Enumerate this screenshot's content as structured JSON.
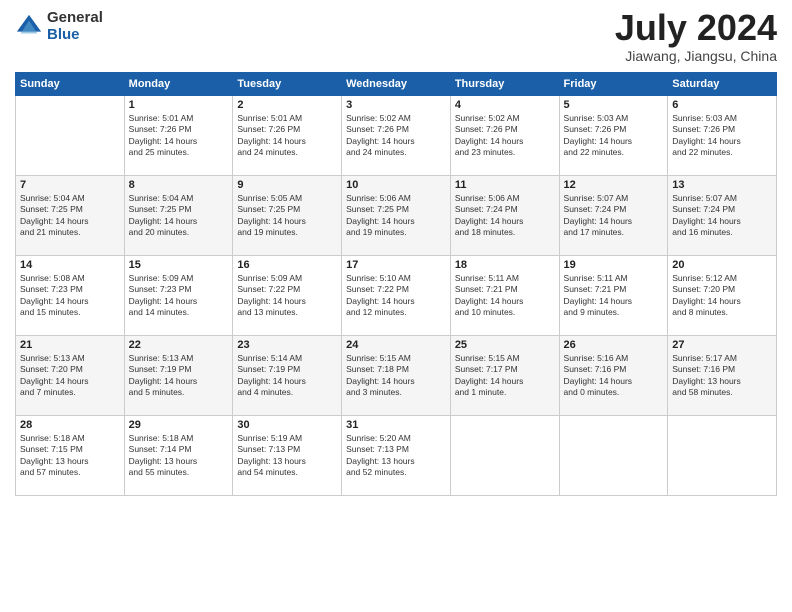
{
  "logo": {
    "general": "General",
    "blue": "Blue"
  },
  "title": "July 2024",
  "location": "Jiawang, Jiangsu, China",
  "days_of_week": [
    "Sunday",
    "Monday",
    "Tuesday",
    "Wednesday",
    "Thursday",
    "Friday",
    "Saturday"
  ],
  "weeks": [
    [
      {
        "day": "",
        "info": ""
      },
      {
        "day": "1",
        "info": "Sunrise: 5:01 AM\nSunset: 7:26 PM\nDaylight: 14 hours\nand 25 minutes."
      },
      {
        "day": "2",
        "info": "Sunrise: 5:01 AM\nSunset: 7:26 PM\nDaylight: 14 hours\nand 24 minutes."
      },
      {
        "day": "3",
        "info": "Sunrise: 5:02 AM\nSunset: 7:26 PM\nDaylight: 14 hours\nand 24 minutes."
      },
      {
        "day": "4",
        "info": "Sunrise: 5:02 AM\nSunset: 7:26 PM\nDaylight: 14 hours\nand 23 minutes."
      },
      {
        "day": "5",
        "info": "Sunrise: 5:03 AM\nSunset: 7:26 PM\nDaylight: 14 hours\nand 22 minutes."
      },
      {
        "day": "6",
        "info": "Sunrise: 5:03 AM\nSunset: 7:26 PM\nDaylight: 14 hours\nand 22 minutes."
      }
    ],
    [
      {
        "day": "7",
        "info": "Sunrise: 5:04 AM\nSunset: 7:25 PM\nDaylight: 14 hours\nand 21 minutes."
      },
      {
        "day": "8",
        "info": "Sunrise: 5:04 AM\nSunset: 7:25 PM\nDaylight: 14 hours\nand 20 minutes."
      },
      {
        "day": "9",
        "info": "Sunrise: 5:05 AM\nSunset: 7:25 PM\nDaylight: 14 hours\nand 19 minutes."
      },
      {
        "day": "10",
        "info": "Sunrise: 5:06 AM\nSunset: 7:25 PM\nDaylight: 14 hours\nand 19 minutes."
      },
      {
        "day": "11",
        "info": "Sunrise: 5:06 AM\nSunset: 7:24 PM\nDaylight: 14 hours\nand 18 minutes."
      },
      {
        "day": "12",
        "info": "Sunrise: 5:07 AM\nSunset: 7:24 PM\nDaylight: 14 hours\nand 17 minutes."
      },
      {
        "day": "13",
        "info": "Sunrise: 5:07 AM\nSunset: 7:24 PM\nDaylight: 14 hours\nand 16 minutes."
      }
    ],
    [
      {
        "day": "14",
        "info": "Sunrise: 5:08 AM\nSunset: 7:23 PM\nDaylight: 14 hours\nand 15 minutes."
      },
      {
        "day": "15",
        "info": "Sunrise: 5:09 AM\nSunset: 7:23 PM\nDaylight: 14 hours\nand 14 minutes."
      },
      {
        "day": "16",
        "info": "Sunrise: 5:09 AM\nSunset: 7:22 PM\nDaylight: 14 hours\nand 13 minutes."
      },
      {
        "day": "17",
        "info": "Sunrise: 5:10 AM\nSunset: 7:22 PM\nDaylight: 14 hours\nand 12 minutes."
      },
      {
        "day": "18",
        "info": "Sunrise: 5:11 AM\nSunset: 7:21 PM\nDaylight: 14 hours\nand 10 minutes."
      },
      {
        "day": "19",
        "info": "Sunrise: 5:11 AM\nSunset: 7:21 PM\nDaylight: 14 hours\nand 9 minutes."
      },
      {
        "day": "20",
        "info": "Sunrise: 5:12 AM\nSunset: 7:20 PM\nDaylight: 14 hours\nand 8 minutes."
      }
    ],
    [
      {
        "day": "21",
        "info": "Sunrise: 5:13 AM\nSunset: 7:20 PM\nDaylight: 14 hours\nand 7 minutes."
      },
      {
        "day": "22",
        "info": "Sunrise: 5:13 AM\nSunset: 7:19 PM\nDaylight: 14 hours\nand 5 minutes."
      },
      {
        "day": "23",
        "info": "Sunrise: 5:14 AM\nSunset: 7:19 PM\nDaylight: 14 hours\nand 4 minutes."
      },
      {
        "day": "24",
        "info": "Sunrise: 5:15 AM\nSunset: 7:18 PM\nDaylight: 14 hours\nand 3 minutes."
      },
      {
        "day": "25",
        "info": "Sunrise: 5:15 AM\nSunset: 7:17 PM\nDaylight: 14 hours\nand 1 minute."
      },
      {
        "day": "26",
        "info": "Sunrise: 5:16 AM\nSunset: 7:16 PM\nDaylight: 14 hours\nand 0 minutes."
      },
      {
        "day": "27",
        "info": "Sunrise: 5:17 AM\nSunset: 7:16 PM\nDaylight: 13 hours\nand 58 minutes."
      }
    ],
    [
      {
        "day": "28",
        "info": "Sunrise: 5:18 AM\nSunset: 7:15 PM\nDaylight: 13 hours\nand 57 minutes."
      },
      {
        "day": "29",
        "info": "Sunrise: 5:18 AM\nSunset: 7:14 PM\nDaylight: 13 hours\nand 55 minutes."
      },
      {
        "day": "30",
        "info": "Sunrise: 5:19 AM\nSunset: 7:13 PM\nDaylight: 13 hours\nand 54 minutes."
      },
      {
        "day": "31",
        "info": "Sunrise: 5:20 AM\nSunset: 7:13 PM\nDaylight: 13 hours\nand 52 minutes."
      },
      {
        "day": "",
        "info": ""
      },
      {
        "day": "",
        "info": ""
      },
      {
        "day": "",
        "info": ""
      }
    ]
  ]
}
